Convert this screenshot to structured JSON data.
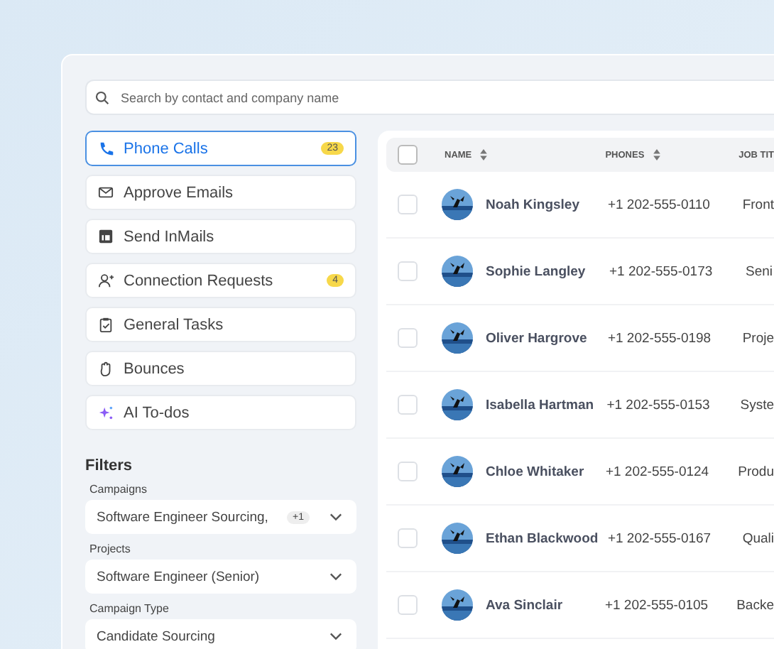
{
  "search": {
    "placeholder": "Search by contact and company name"
  },
  "tasks": [
    {
      "label": "Phone Calls",
      "selected": true,
      "count": "23"
    },
    {
      "label": "Approve Emails",
      "selected": false
    },
    {
      "label": "Send InMails",
      "selected": false
    },
    {
      "label": "Connection Requests",
      "selected": false,
      "count": "4"
    },
    {
      "label": "General Tasks",
      "selected": false
    },
    {
      "label": "Bounces",
      "selected": false
    },
    {
      "label": "AI To-dos",
      "selected": false
    }
  ],
  "filters": {
    "title": "Filters",
    "fields": [
      {
        "label": "Campaigns",
        "value": "Software Engineer Sourcing,",
        "extra": "+1"
      },
      {
        "label": "Projects",
        "value": "Software Engineer (Senior)"
      },
      {
        "label": "Campaign Type",
        "value": "Candidate Sourcing"
      }
    ]
  },
  "table": {
    "all_checked": false,
    "columns": [
      {
        "label": "NAME",
        "sortable": true
      },
      {
        "label": "PHONES",
        "sortable": true
      },
      {
        "label": "JOB TIT",
        "sortable": false
      }
    ],
    "rows": [
      {
        "name": "Noah Kingsley",
        "phone": "+1 202-555-0110",
        "job": "Front",
        "checked": false
      },
      {
        "name": "Sophie Langley",
        "phone": "+1 202-555-0173",
        "job": "Seni",
        "checked": false
      },
      {
        "name": "Oliver Hargrove",
        "phone": "+1 202-555-0198",
        "job": "Proje",
        "checked": false
      },
      {
        "name": "Isabella Hartman",
        "phone": "+1 202-555-0153",
        "job": "Syste",
        "checked": false
      },
      {
        "name": "Chloe Whitaker",
        "phone": "+1 202-555-0124",
        "job": "Produ",
        "checked": false
      },
      {
        "name": "Ethan Blackwood",
        "phone": "+1 202-555-0167",
        "job": "Quali",
        "checked": false
      },
      {
        "name": "Ava Sinclair",
        "phone": "+1 202-555-0105",
        "job": "Backe",
        "checked": false
      }
    ]
  }
}
